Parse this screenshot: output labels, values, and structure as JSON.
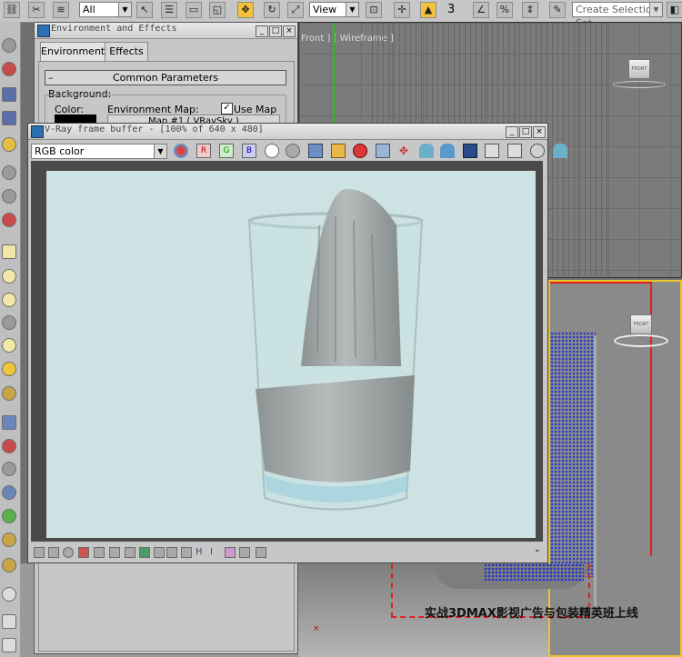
{
  "toolbar": {
    "selection_filter": "All",
    "reference_coord": "View",
    "snap_value": "3",
    "selection_set_placeholder": "Create Selection Set"
  },
  "viewport_top": {
    "label": "Front ] [ Wireframe ]",
    "viewcube_label": "FRONT"
  },
  "viewport_persp": {
    "viewcube_label": "FRONT"
  },
  "env_dialog": {
    "title": "Environment and Effects",
    "tabs": [
      "Environment",
      "Effects"
    ],
    "rollout": "Common Parameters",
    "group_label": "Background:",
    "color_label": "Color:",
    "env_map_label": "Environment Map:",
    "use_map_label": "Use Map",
    "use_map_checked": true,
    "map_button": "Map #1  ( VRaySky )"
  },
  "vray_fb": {
    "title": "V-Ray frame buffer - [100% of 640 x 480]",
    "channel": "RGB color"
  },
  "watermark": "实战3DMAX影视广告与包装精英班上线",
  "colors": {
    "accent_yellow": "#e8c52a",
    "render_bg": "#cde2e2",
    "bbox_red": "#e02020",
    "particles_blue": "#1a2fd6"
  }
}
